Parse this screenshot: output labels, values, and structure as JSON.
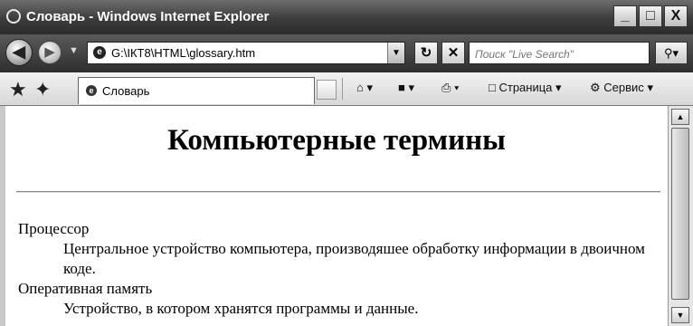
{
  "window": {
    "title": "Словарь - Windows Internet Explorer",
    "controls": {
      "minimize": "_",
      "maximize": "□",
      "close": "X"
    }
  },
  "address_bar": {
    "url": "G:\\ІКТ8\\HTML\\glossary.htm"
  },
  "search": {
    "placeholder": "Поиск \"Live Search\""
  },
  "tab": {
    "label": "Словарь"
  },
  "command_bar": {
    "page_label": "Страница",
    "tools_label": "Сервис"
  },
  "page": {
    "heading": "Компьютерные термины",
    "terms": [
      {
        "term": "Процессор",
        "definition": "Центральное устройство компьютера, производяшее обработку информации в двоичном коде."
      },
      {
        "term": "Оперативная память",
        "definition": "Устройство, в котором хранятся программы и данные."
      }
    ]
  }
}
